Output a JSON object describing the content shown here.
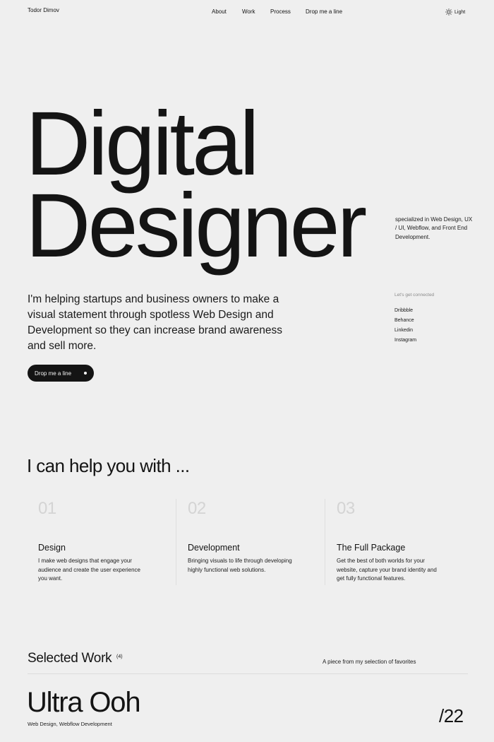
{
  "nav": {
    "brand": "Todor Dimov",
    "links": [
      "About",
      "Work",
      "Process",
      "Drop me a line"
    ],
    "theme_label": "Light",
    "theme_icon": "sun-icon"
  },
  "hero": {
    "line1": "Digital",
    "line2": "Designer",
    "specialized": "specialized in Web Design, UX / UI, Webflow, and Front End Development.",
    "intro": "I'm helping startups and business owners to make a visual statement through spotless Web Design and Development so they can increase brand awareness and sell more.",
    "cta_label": "Drop me a line"
  },
  "connect": {
    "title": "Let's get connected",
    "links": [
      "Dribbble",
      "Behance",
      "Linkedin",
      "Instagram"
    ]
  },
  "help": {
    "title": "I can help you with ...",
    "items": [
      {
        "num": "01",
        "title": "Design",
        "desc": "I make web designs that engage your audience and create the user experience you want."
      },
      {
        "num": "02",
        "title": "Development",
        "desc": "Bringing visuals to life through developing highly functional web solutions."
      },
      {
        "num": "03",
        "title": "The Full Package",
        "desc": "Get the best of both worlds for your website, capture your brand identity and get fully functional features."
      }
    ]
  },
  "work": {
    "title": "Selected Work",
    "count": "(4)",
    "subtitle": "A piece from my selection of favorites",
    "project": {
      "title": "Ultra Ooh",
      "tags": "Web Design, Webflow Development",
      "year": "/22"
    }
  },
  "colors": {
    "background": "#efefef",
    "text": "#141414",
    "muted_number": "#d4d4d4",
    "button_bg": "#141414"
  }
}
